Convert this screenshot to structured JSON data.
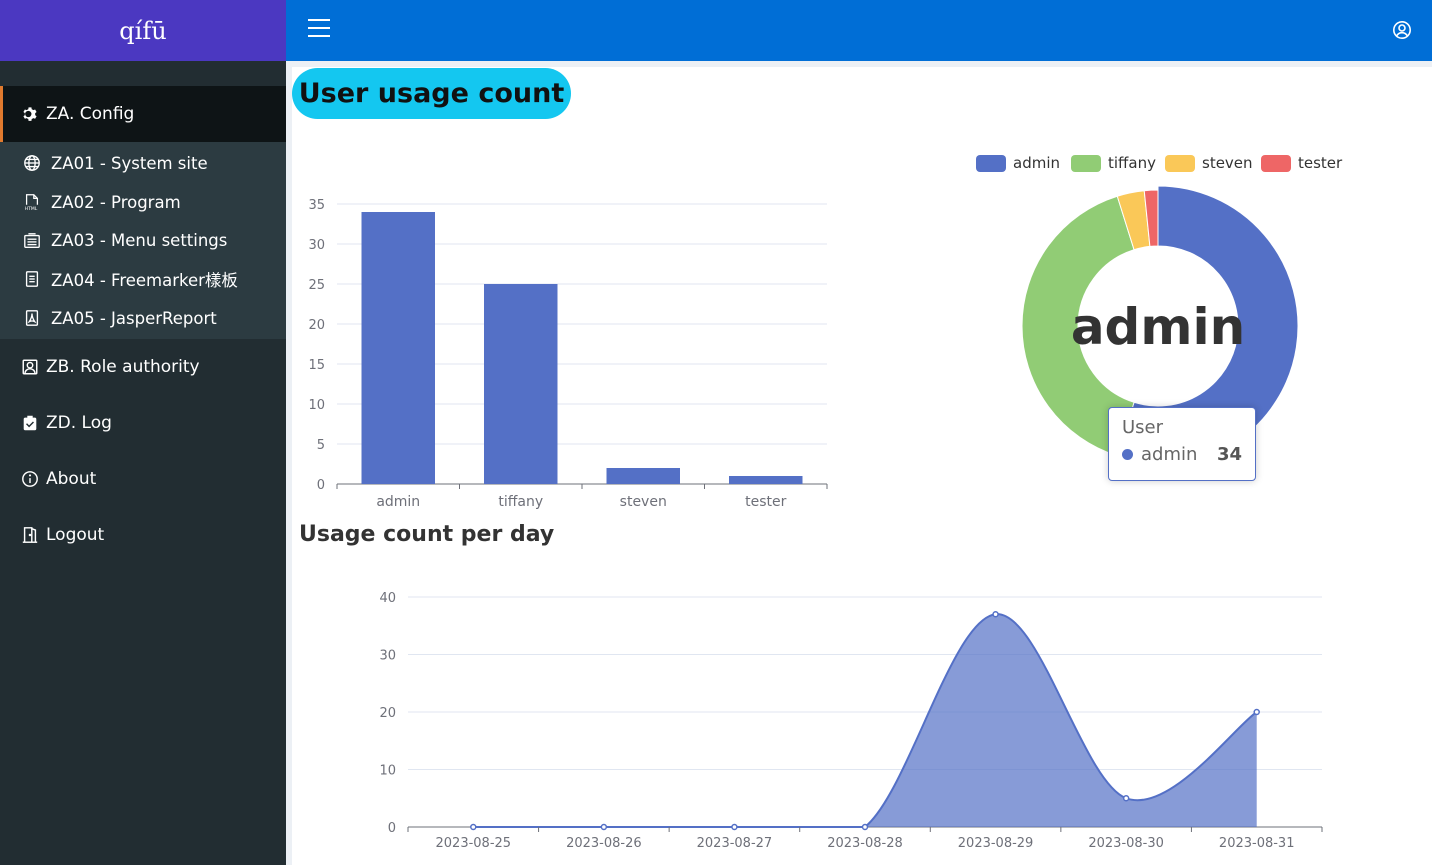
{
  "app": {
    "brand": "qífū"
  },
  "sidebar": {
    "groups": [
      {
        "label": "ZA. Config",
        "icon": "gear-icon",
        "active": true
      },
      {
        "label": "ZB. Role authority",
        "icon": "user-portrait-icon"
      },
      {
        "label": "ZD. Log",
        "icon": "clipboard-check-icon"
      },
      {
        "label": "About",
        "icon": "info-icon"
      },
      {
        "label": "Logout",
        "icon": "door-icon"
      }
    ],
    "submenu": [
      {
        "label": "ZA01 - System site",
        "icon": "globe-icon"
      },
      {
        "label": "ZA02 - Program",
        "icon": "html-file-icon"
      },
      {
        "label": "ZA03 - Menu settings",
        "icon": "menu-list-icon"
      },
      {
        "label": "ZA04 - Freemarker樣板",
        "icon": "document-icon"
      },
      {
        "label": "ZA05 - JasperReport",
        "icon": "pdf-file-icon"
      }
    ]
  },
  "header": {
    "hamburger_icon": "hamburger-icon",
    "user_icon": "user-circle-icon"
  },
  "main": {
    "title": "User usage count",
    "daily_title": "Usage count per day"
  },
  "colors": {
    "blue": "#5470c6",
    "green": "#91cc75",
    "yellow": "#fac858",
    "red": "#ee6666",
    "pill": "#14c7f0",
    "topbar": "#006ed6",
    "brand": "#4b38c1",
    "sidebar": "#222d32"
  },
  "chart_data": [
    {
      "type": "bar",
      "categories": [
        "admin",
        "tiffany",
        "steven",
        "tester"
      ],
      "values": [
        34,
        25,
        2,
        1
      ],
      "ylim": [
        0,
        35
      ],
      "yticks": [
        "0",
        "5",
        "10",
        "15",
        "20",
        "25",
        "30",
        "35"
      ],
      "grid": true
    },
    {
      "type": "pie",
      "donut": true,
      "legend": [
        "admin",
        "tiffany",
        "steven",
        "tester"
      ],
      "legend_position": "top-right",
      "slices": [
        {
          "name": "admin",
          "value": 34
        },
        {
          "name": "tiffany",
          "value": 25
        },
        {
          "name": "steven",
          "value": 2
        },
        {
          "name": "tester",
          "value": 1
        }
      ],
      "center_label": "admin",
      "tooltip": {
        "title": "User",
        "name": "admin",
        "value": "34"
      }
    },
    {
      "type": "area",
      "x": [
        "2023-08-25",
        "2023-08-26",
        "2023-08-27",
        "2023-08-28",
        "2023-08-29",
        "2023-08-30",
        "2023-08-31"
      ],
      "values": [
        0,
        0,
        0,
        0,
        37,
        5,
        20
      ],
      "ylim": [
        0,
        40
      ],
      "yticks": [
        "0",
        "10",
        "20",
        "30",
        "40"
      ],
      "smooth": true,
      "grid": true
    }
  ]
}
